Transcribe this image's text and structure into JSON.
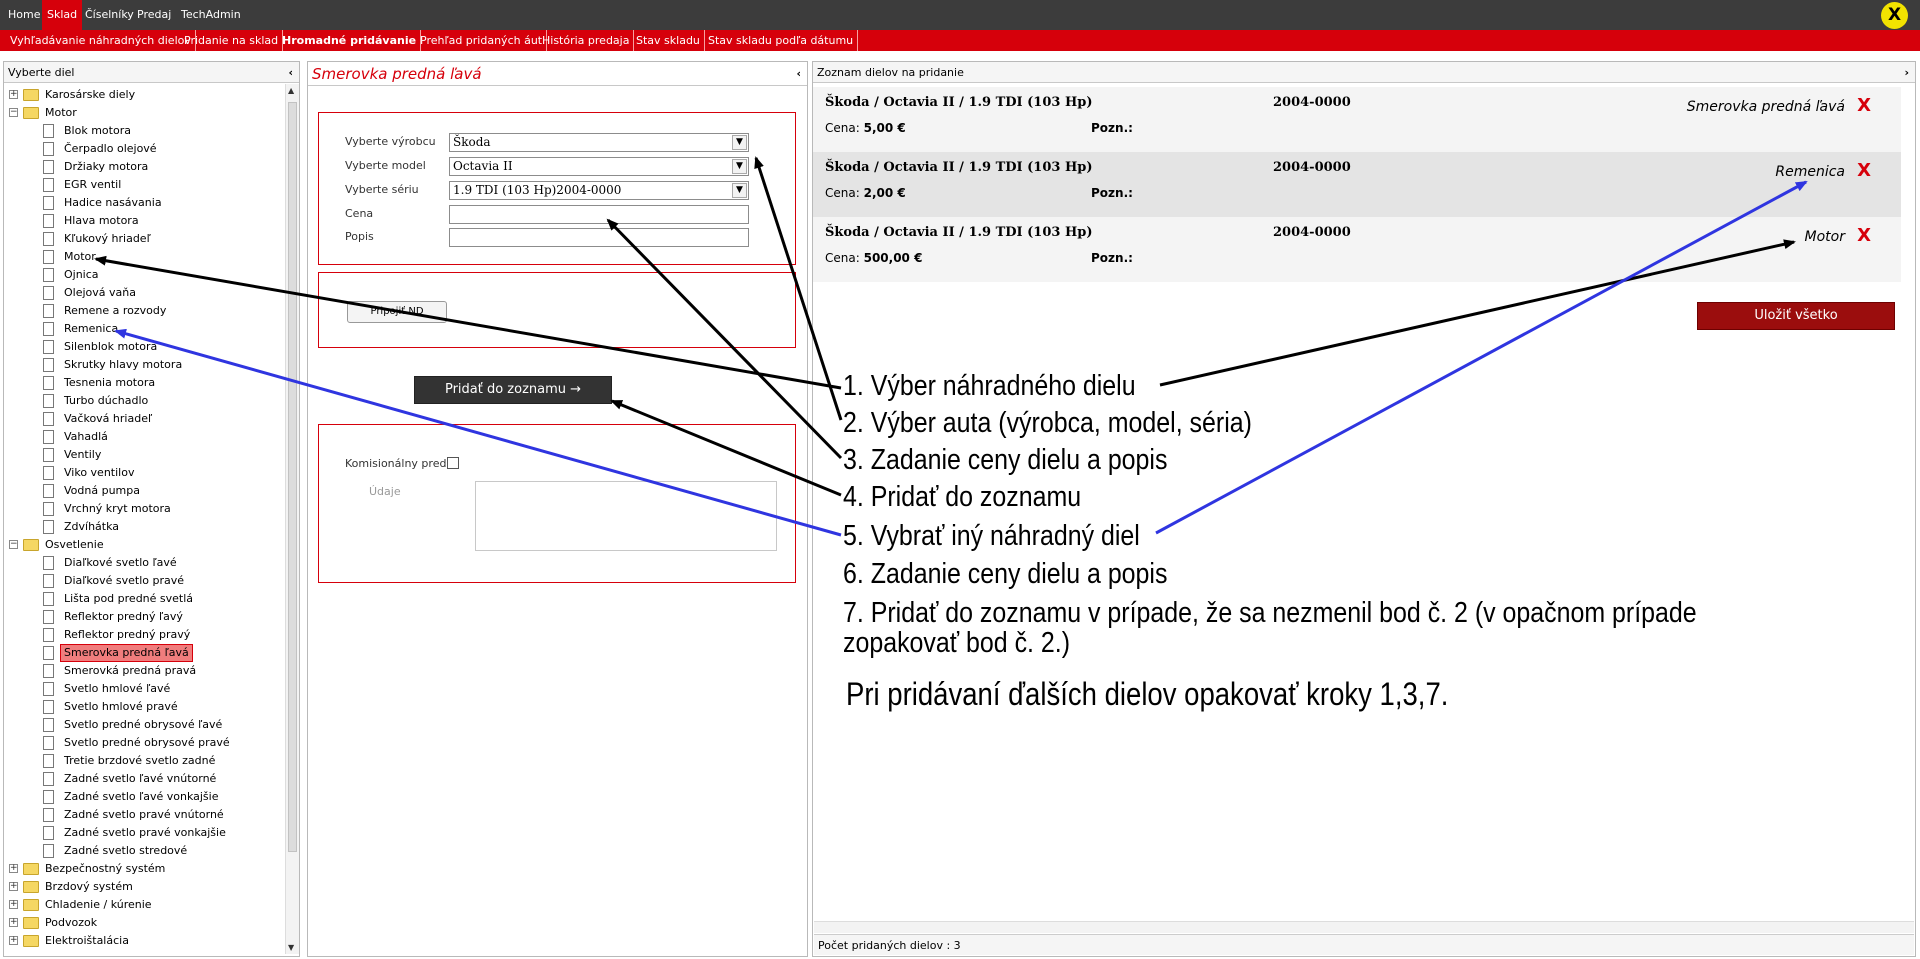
{
  "topnav": {
    "items": [
      "Home",
      "Sklad",
      "Číselníky",
      "Predaj",
      "TechAdmin"
    ],
    "active_index": 1,
    "close_label": "X"
  },
  "subnav": {
    "items": [
      "Vyhľadávanie náhradných dielov",
      "Pridanie na sklad",
      "Hromadné pridávanie",
      "Prehľad pridaných áut",
      "História predaja",
      "Stav skladu",
      "Stav skladu podľa dátumu"
    ],
    "active_index": 2
  },
  "tree_panel": {
    "title": "Vyberte diel",
    "nodes": [
      {
        "label": "Karosárske diely",
        "type": "folder",
        "expander": "+"
      },
      {
        "label": "Motor",
        "type": "folder",
        "expander": "−",
        "open": true
      },
      {
        "label": "Blok motora",
        "type": "leaf"
      },
      {
        "label": "Čerpadlo olejové",
        "type": "leaf"
      },
      {
        "label": "Držiaky motora",
        "type": "leaf"
      },
      {
        "label": "EGR ventil",
        "type": "leaf"
      },
      {
        "label": "Hadice nasávania",
        "type": "leaf"
      },
      {
        "label": "Hlava motora",
        "type": "leaf"
      },
      {
        "label": "Kľukový hriadeľ",
        "type": "leaf"
      },
      {
        "label": "Motor",
        "type": "leaf"
      },
      {
        "label": "Ojnica",
        "type": "leaf"
      },
      {
        "label": "Olejová vaňa",
        "type": "leaf"
      },
      {
        "label": "Remene a rozvody",
        "type": "leaf"
      },
      {
        "label": "Remenica",
        "type": "leaf"
      },
      {
        "label": "Silenblok motora",
        "type": "leaf"
      },
      {
        "label": "Skrutky hlavy motora",
        "type": "leaf"
      },
      {
        "label": "Tesnenia motora",
        "type": "leaf"
      },
      {
        "label": "Turbo dúchadlo",
        "type": "leaf"
      },
      {
        "label": "Vačková hriadeľ",
        "type": "leaf"
      },
      {
        "label": "Vahadlá",
        "type": "leaf"
      },
      {
        "label": "Ventily",
        "type": "leaf"
      },
      {
        "label": "Viko ventilov",
        "type": "leaf"
      },
      {
        "label": "Vodná pumpa",
        "type": "leaf"
      },
      {
        "label": "Vrchný kryt motora",
        "type": "leaf"
      },
      {
        "label": "Zdvíhátka",
        "type": "leaf"
      },
      {
        "label": "Osvetlenie",
        "type": "folder",
        "expander": "−",
        "open": true
      },
      {
        "label": "Diaľkové svetlo ľavé",
        "type": "leaf"
      },
      {
        "label": "Diaľkové svetlo pravé",
        "type": "leaf"
      },
      {
        "label": "Lišta pod predné svetlá",
        "type": "leaf"
      },
      {
        "label": "Reflektor predný ľavý",
        "type": "leaf"
      },
      {
        "label": "Reflektor predný pravý",
        "type": "leaf"
      },
      {
        "label": "Smerovka predná ľavá",
        "type": "leaf",
        "selected": true
      },
      {
        "label": "Smerovká predná pravá",
        "type": "leaf"
      },
      {
        "label": "Svetlo hmlové ľavé",
        "type": "leaf"
      },
      {
        "label": "Svetlo hmlové pravé",
        "type": "leaf"
      },
      {
        "label": "Svetlo predné obrysové ľavé",
        "type": "leaf"
      },
      {
        "label": "Svetlo predné obrysové pravé",
        "type": "leaf"
      },
      {
        "label": "Tretie brzdové svetlo zadné",
        "type": "leaf"
      },
      {
        "label": "Zadné svetlo ľavé vnútorné",
        "type": "leaf"
      },
      {
        "label": "Zadné svetlo ľavé vonkajšie",
        "type": "leaf"
      },
      {
        "label": "Zadné svetlo pravé vnútorné",
        "type": "leaf"
      },
      {
        "label": "Zadné svetlo pravé vonkajšie",
        "type": "leaf"
      },
      {
        "label": "Zadné svetlo stredové",
        "type": "leaf"
      },
      {
        "label": "Bezpečnostný systém",
        "type": "folder",
        "expander": "+"
      },
      {
        "label": "Brzdový systém",
        "type": "folder",
        "expander": "+"
      },
      {
        "label": "Chladenie / kúrenie",
        "type": "folder",
        "expander": "+"
      },
      {
        "label": "Podvozok",
        "type": "folder",
        "expander": "+"
      },
      {
        "label": "Elektroištalácia",
        "type": "folder",
        "expander": "+"
      }
    ]
  },
  "form_panel": {
    "title": "Smerovka predná ľavá",
    "labels": {
      "manufacturer": "Vyberte výrobcu",
      "model": "Vyberte model",
      "series": "Vyberte sériu",
      "price": "Cena",
      "description": "Popis"
    },
    "values": {
      "manufacturer": "Škoda",
      "model": "Octavia II",
      "series": "1.9 TDI (103 Hp)2004-0000",
      "price": "",
      "description": ""
    },
    "attach_button": "Pripojiť ND",
    "add_button": "Pridať do zoznamu →",
    "consignment_label": "Komisionálny predaj",
    "details_label": "Údaje"
  },
  "list_panel": {
    "title": "Zoznam dielov na pridanie",
    "price_label": "Cena:",
    "note_label": "Pozn.:",
    "delete_label": "X",
    "items": [
      {
        "car": "Škoda / Octavia II / 1.9 TDI (103 Hp)",
        "code": "2004-0000",
        "price": "5,00 €",
        "part": "Smerovka predná ľavá"
      },
      {
        "car": "Škoda / Octavia II / 1.9 TDI (103 Hp)",
        "code": "2004-0000",
        "price": "2,00 €",
        "part": "Remenica"
      },
      {
        "car": "Škoda / Octavia II / 1.9 TDI (103 Hp)",
        "code": "2004-0000",
        "price": "500,00 €",
        "part": "Motor"
      }
    ],
    "save_all_button": "Uložiť všetko",
    "status": "Počet pridaných dielov : 3"
  },
  "annotations": [
    "1. Výber náhradného dielu",
    "2. Výber auta (výrobca, model, séria)",
    "3. Zadanie ceny dielu a popis",
    "4. Pridať do zoznamu",
    "5. Vybrať iný náhradný diel",
    "6. Zadanie ceny dielu a popis",
    "7. Pridať do zoznamu v prípade, že sa nezmenil bod č. 2 (v opačnom prípade zopakovať bod č. 2.)",
    "Pri pridávaní ďalších dielov opakovať kroky 1,3,7."
  ],
  "colors": {
    "accent": "#d6000b",
    "topnav_bg": "#3c3c3c",
    "save_button": "#9b0d0d",
    "arrow_black": "#000000",
    "arrow_blue": "#2f35e0"
  }
}
